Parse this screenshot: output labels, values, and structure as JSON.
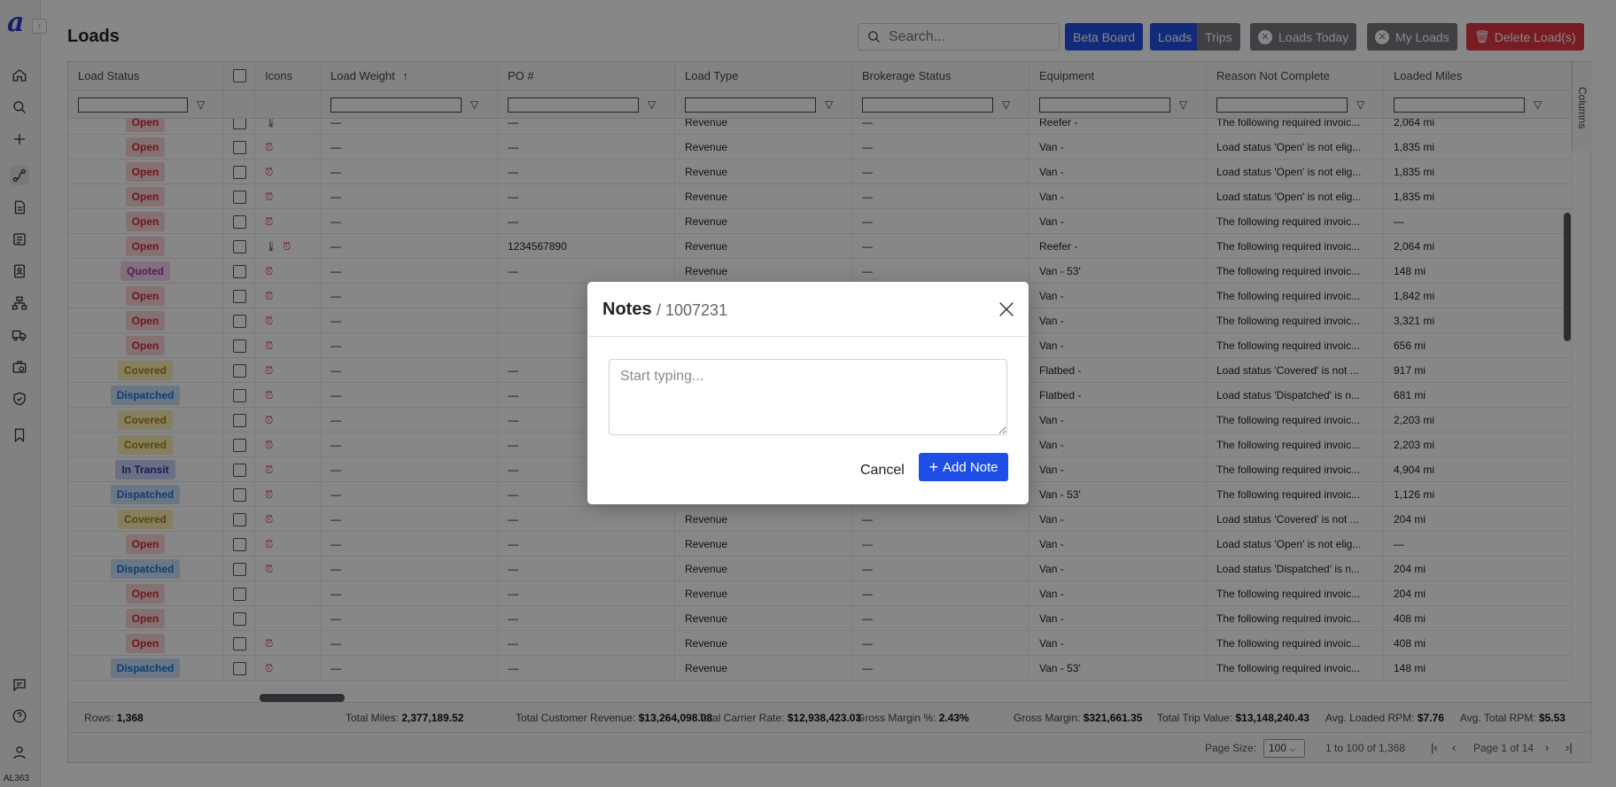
{
  "app": {
    "logo_letter": "a",
    "expand_glyph": "›",
    "tenant_code": "AL363",
    "nav_icons": [
      "home-icon",
      "search-icon",
      "plus-icon",
      "route-icon",
      "document-icon",
      "invoice-icon",
      "contacts-icon",
      "org-chart-icon",
      "truck-icon",
      "briefcase-icon",
      "shield-icon",
      "bookmark-icon",
      "chat-icon",
      "help-icon",
      "user-icon"
    ]
  },
  "page": {
    "title": "Loads"
  },
  "toolbar": {
    "search_placeholder": "Search...",
    "beta_board": "Beta Board",
    "loads": "Loads",
    "trips": "Trips",
    "loads_today": "Loads Today",
    "my_loads": "My Loads",
    "delete_loads": "Delete Load(s)",
    "colors": {
      "blue": "#2350e6",
      "gray": "#767a80",
      "red": "#e23645"
    }
  },
  "grid": {
    "columns": [
      "Load Status",
      "",
      "Icons",
      "Load Weight",
      "PO #",
      "Load Type",
      "Brokerage Status",
      "Equipment",
      "Reason Not Complete",
      "Loaded Miles"
    ],
    "sort_indicator": "↑",
    "columns_tab_label": "Columns",
    "rows": [
      {
        "status": "Open",
        "icons": "thermo",
        "weight": "—",
        "po": "—",
        "type": "Revenue",
        "brokerage": "—",
        "equipment": "Reefer -",
        "reason": "The following required invoic...",
        "miles": "2,064 mi"
      },
      {
        "status": "Open",
        "icons": "alarm",
        "weight": "—",
        "po": "—",
        "type": "Revenue",
        "brokerage": "—",
        "equipment": "Van -",
        "reason": "Load status 'Open' is not elig...",
        "miles": "1,835 mi"
      },
      {
        "status": "Open",
        "icons": "alarm",
        "weight": "—",
        "po": "—",
        "type": "Revenue",
        "brokerage": "—",
        "equipment": "Van -",
        "reason": "Load status 'Open' is not elig...",
        "miles": "1,835 mi"
      },
      {
        "status": "Open",
        "icons": "alarm",
        "weight": "—",
        "po": "—",
        "type": "Revenue",
        "brokerage": "—",
        "equipment": "Van -",
        "reason": "Load status 'Open' is not elig...",
        "miles": "1,835 mi"
      },
      {
        "status": "Open",
        "icons": "alarm",
        "weight": "—",
        "po": "—",
        "type": "Revenue",
        "brokerage": "—",
        "equipment": "Van -",
        "reason": "The following required invoic...",
        "miles": "—"
      },
      {
        "status": "Open",
        "icons": "thermo-alarm",
        "weight": "—",
        "po": "1234567890",
        "type": "Revenue",
        "brokerage": "—",
        "equipment": "Reefer -",
        "reason": "The following required invoic...",
        "miles": "2,064 mi"
      },
      {
        "status": "Quoted",
        "icons": "alarm",
        "weight": "—",
        "po": "—",
        "type": "Revenue",
        "brokerage": "—",
        "equipment": "Van - 53'",
        "reason": "The following required invoic...",
        "miles": "148 mi"
      },
      {
        "status": "Open",
        "icons": "alarm",
        "weight": "—",
        "po": "",
        "type": "",
        "brokerage": "",
        "equipment": "Van -",
        "reason": "The following required invoic...",
        "miles": "1,842 mi"
      },
      {
        "status": "Open",
        "icons": "alarm",
        "weight": "—",
        "po": "",
        "type": "",
        "brokerage": "",
        "equipment": "Van -",
        "reason": "The following required invoic...",
        "miles": "3,321 mi"
      },
      {
        "status": "Open",
        "icons": "alarm",
        "weight": "—",
        "po": "",
        "type": "",
        "brokerage": "",
        "equipment": "Van -",
        "reason": "The following required invoic...",
        "miles": "656 mi"
      },
      {
        "status": "Covered",
        "icons": "alarm",
        "weight": "—",
        "po": "—",
        "type": "",
        "brokerage": "",
        "equipment": "Flatbed -",
        "reason": "Load status 'Covered' is not ...",
        "miles": "917 mi"
      },
      {
        "status": "Dispatched",
        "icons": "alarm",
        "weight": "—",
        "po": "—",
        "type": "",
        "brokerage": "",
        "equipment": "Flatbed -",
        "reason": "Load status 'Dispatched' is n...",
        "miles": "681 mi"
      },
      {
        "status": "Covered",
        "icons": "alarm",
        "weight": "—",
        "po": "—",
        "type": "",
        "brokerage": "",
        "equipment": "Van -",
        "reason": "The following required invoic...",
        "miles": "2,203 mi"
      },
      {
        "status": "Covered",
        "icons": "alarm",
        "weight": "—",
        "po": "—",
        "type": "",
        "brokerage": "",
        "equipment": "Van -",
        "reason": "The following required invoic...",
        "miles": "2,203 mi"
      },
      {
        "status": "In Transit",
        "icons": "alarm",
        "weight": "—",
        "po": "—",
        "type": "",
        "brokerage": "",
        "equipment": "Van -",
        "reason": "The following required invoic...",
        "miles": "4,904 mi"
      },
      {
        "status": "Dispatched",
        "icons": "alarm",
        "weight": "—",
        "po": "—",
        "type": "",
        "brokerage": "",
        "equipment": "Van - 53'",
        "reason": "The following required invoic...",
        "miles": "1,126 mi"
      },
      {
        "status": "Covered",
        "icons": "alarm",
        "weight": "—",
        "po": "—",
        "type": "Revenue",
        "brokerage": "—",
        "equipment": "Van -",
        "reason": "Load status 'Covered' is not ...",
        "miles": "204 mi"
      },
      {
        "status": "Open",
        "icons": "alarm",
        "weight": "—",
        "po": "—",
        "type": "Revenue",
        "brokerage": "—",
        "equipment": "Van -",
        "reason": "Load status 'Open' is not elig...",
        "miles": "—"
      },
      {
        "status": "Dispatched",
        "icons": "alarm",
        "weight": "—",
        "po": "—",
        "type": "Revenue",
        "brokerage": "—",
        "equipment": "Van -",
        "reason": "Load status 'Dispatched' is n...",
        "miles": "204 mi"
      },
      {
        "status": "Open",
        "icons": "",
        "weight": "—",
        "po": "—",
        "type": "Revenue",
        "brokerage": "—",
        "equipment": "Van -",
        "reason": "The following required invoic...",
        "miles": "204 mi"
      },
      {
        "status": "Open",
        "icons": "",
        "weight": "—",
        "po": "—",
        "type": "Revenue",
        "brokerage": "—",
        "equipment": "Van -",
        "reason": "The following required invoic...",
        "miles": "408 mi"
      },
      {
        "status": "Open",
        "icons": "alarm",
        "weight": "—",
        "po": "—",
        "type": "Revenue",
        "brokerage": "—",
        "equipment": "Van -",
        "reason": "The following required invoic...",
        "miles": "408 mi"
      },
      {
        "status": "Dispatched",
        "icons": "alarm",
        "weight": "—",
        "po": "—",
        "type": "Revenue",
        "brokerage": "—",
        "equipment": "Van - 53'",
        "reason": "The following required invoic...",
        "miles": "148 mi"
      }
    ]
  },
  "totals": {
    "rows_label": "Rows:",
    "rows_value": "1,368",
    "miles_label": "Total Miles:",
    "miles_value": "2,377,189.52",
    "cust_rev_label": "Total Customer Revenue:",
    "cust_rev_value": "$13,264,098.08",
    "carrier_label": "Total Carrier Rate:",
    "carrier_value": "$12,938,423.03",
    "gm_pct_label": "Gross Margin %:",
    "gm_pct_value": "2.43%",
    "gm_label": "Gross Margin:",
    "gm_value": "$321,661.35",
    "trip_label": "Total Trip Value:",
    "trip_value": "$13,148,240.43",
    "lrpm_label": "Avg. Loaded RPM:",
    "lrpm_value": "$7.76",
    "trpm_label": "Avg. Total RPM:",
    "trpm_value": "$5.53"
  },
  "pager": {
    "page_size_label": "Page Size:",
    "page_size_value": "100",
    "range": "1 to 100 of 1,368",
    "page_info": "Page 1 of 14"
  },
  "modal": {
    "title": "Notes",
    "subtitle": "/ 1007231",
    "placeholder": "Start typing...",
    "cancel": "Cancel",
    "add_note": "Add Note",
    "accent": "#1d4fe6"
  }
}
